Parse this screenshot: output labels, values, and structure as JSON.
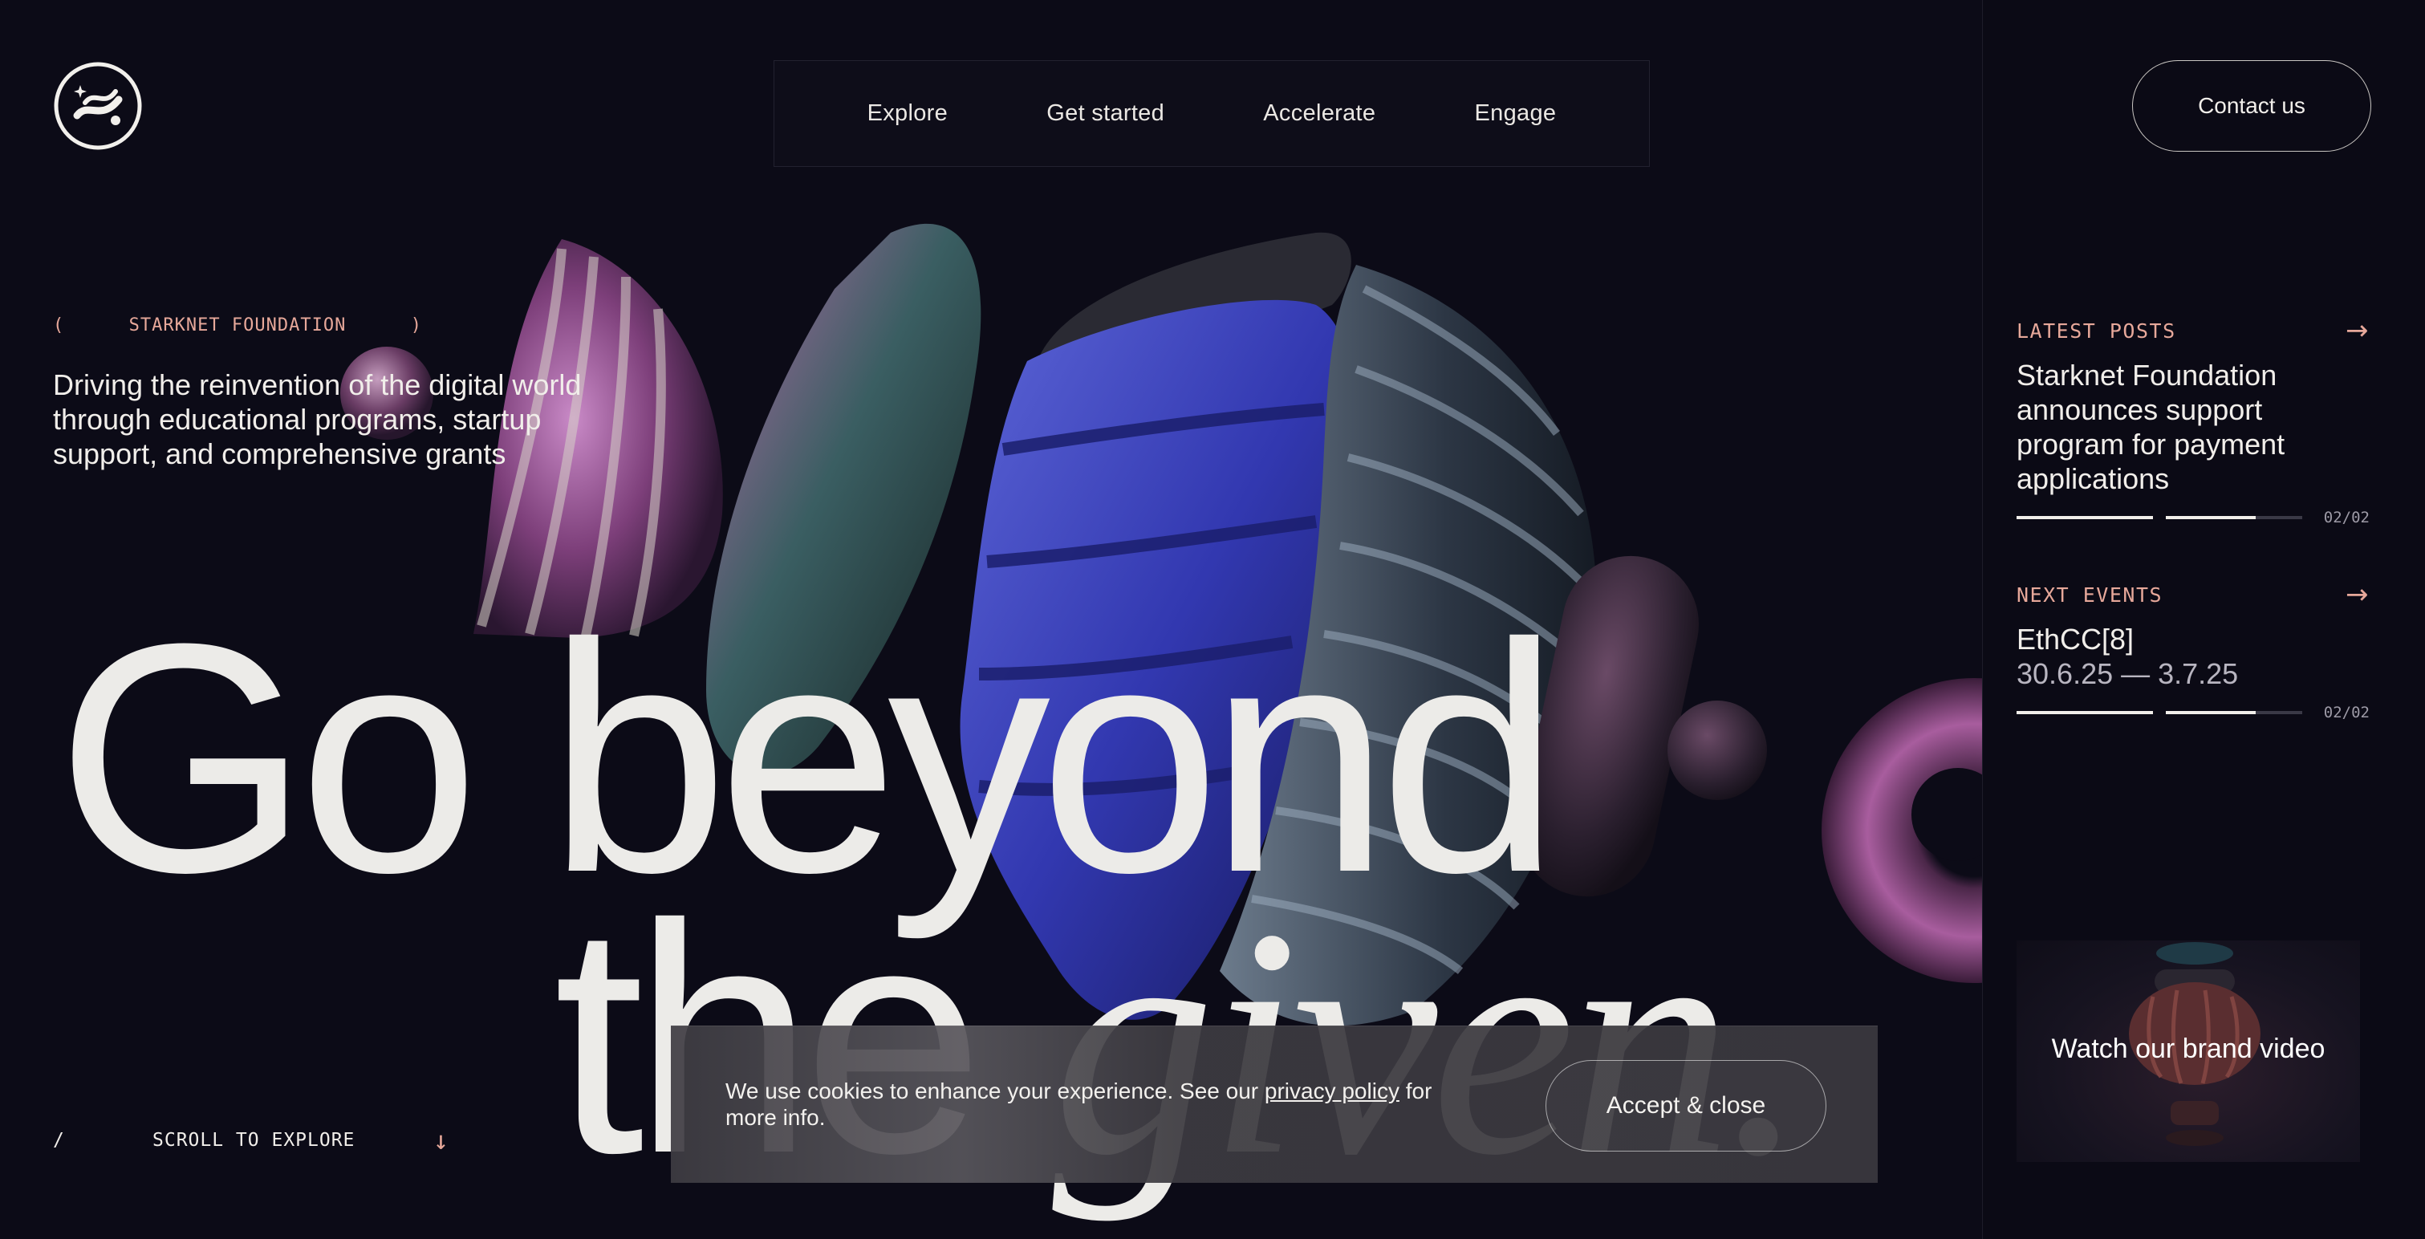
{
  "nav": {
    "items": [
      "Explore",
      "Get started",
      "Accelerate",
      "Engage"
    ]
  },
  "contact_label": "Contact us",
  "hero": {
    "eyebrow_open": "(",
    "eyebrow_text": "STARKNET FOUNDATION",
    "eyebrow_close": ")",
    "intro": "Driving the reinvention of the digital world through educational programs, startup support, and comprehensive grants",
    "headline_line1": "Go beyond",
    "headline_line2_plain": "the ",
    "headline_line2_italic": "given."
  },
  "scroll": {
    "slash": "/",
    "label": "SCROLL TO EXPLORE",
    "arrow": "↓"
  },
  "cookie": {
    "text_before": "We use cookies to enhance your experience. See our ",
    "link": "privacy policy",
    "text_after": " for more info.",
    "accept_label": "Accept & close"
  },
  "sidebar": {
    "latest_posts": {
      "heading": "LATEST POSTS",
      "arrow": "→",
      "title": "Starknet Foundation announces support program for payment applications",
      "counter": "02/02",
      "progress": [
        1.0,
        0.66
      ]
    },
    "next_events": {
      "heading": "NEXT EVENTS",
      "arrow": "→",
      "title": "EthCC[8]",
      "date": "30.6.25  —  3.7.25",
      "counter": "02/02",
      "progress": [
        1.0,
        0.66
      ]
    },
    "video_label": "Watch our brand video"
  },
  "colors": {
    "background": "#0c0b17",
    "accent": "#e7a89a",
    "text": "#f1eeea"
  }
}
